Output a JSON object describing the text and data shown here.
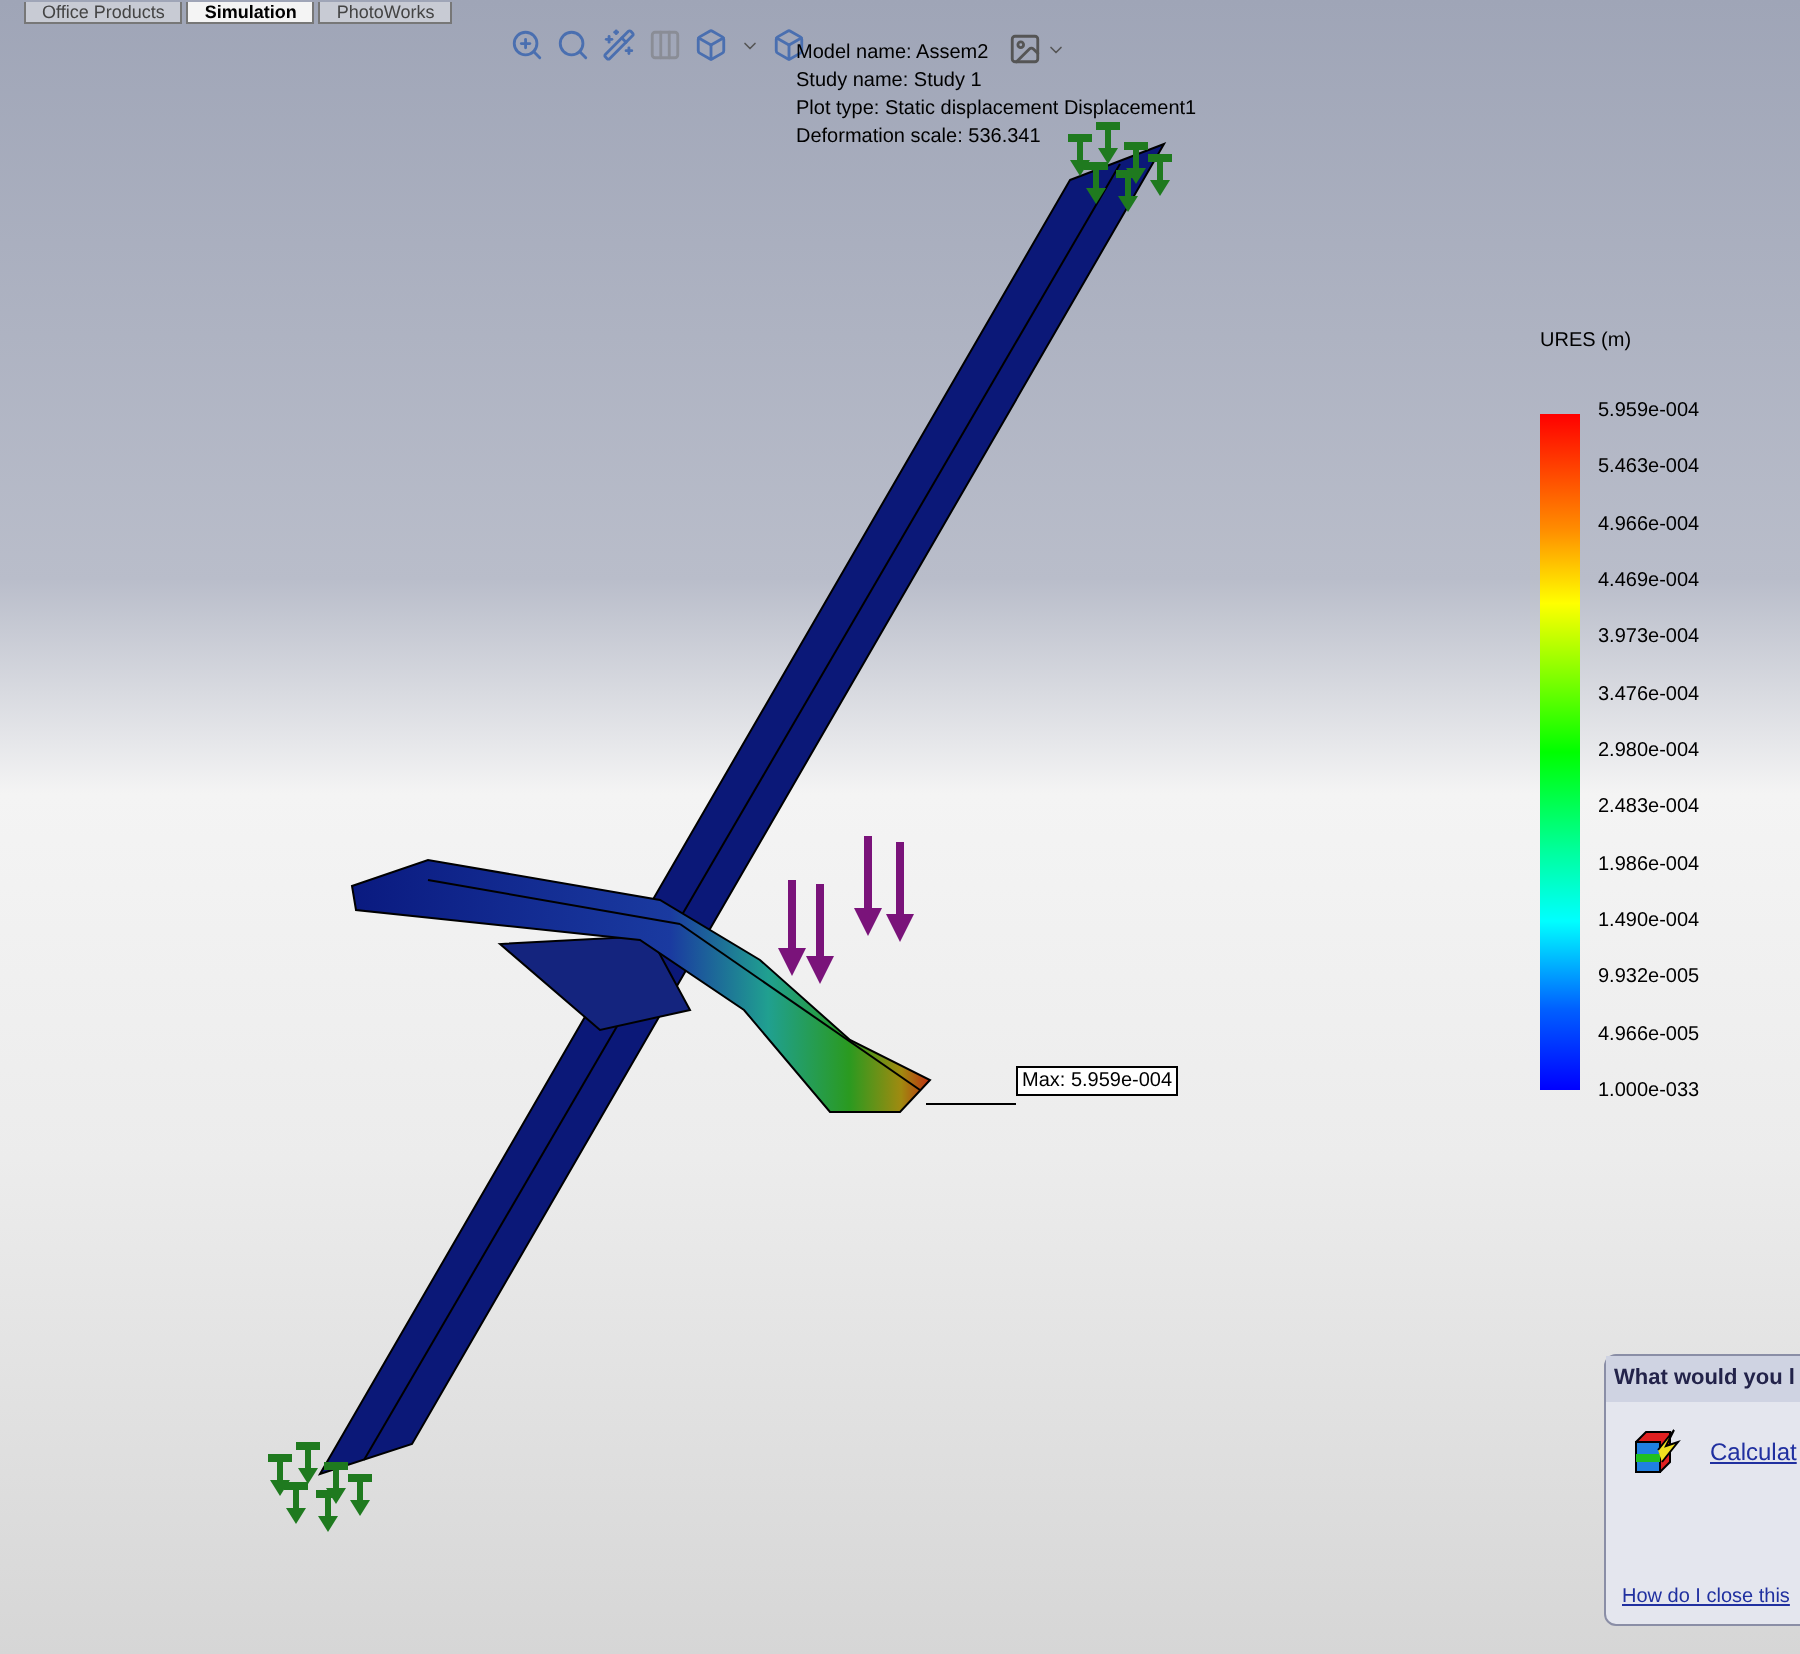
{
  "tabs": [
    {
      "label": "Office Products",
      "selected": false
    },
    {
      "label": "Simulation",
      "selected": true
    },
    {
      "label": "PhotoWorks",
      "selected": false
    }
  ],
  "plot_info": [
    "Model name: Assem2",
    "Study name: Study 1",
    "Plot type: Static displacement Displacement1",
    "Deformation scale: 536.341"
  ],
  "legend": {
    "title": "URES (m)",
    "labels": [
      "5.959e-004",
      "5.463e-004",
      "4.966e-004",
      "4.469e-004",
      "3.973e-004",
      "3.476e-004",
      "2.980e-004",
      "2.483e-004",
      "1.986e-004",
      "1.490e-004",
      "9.932e-005",
      "4.966e-005",
      "1.000e-033"
    ]
  },
  "max_label": "Max: 5.959e-004",
  "help_panel": {
    "title": "What would you l",
    "link": "Calculat",
    "footer_link": "How do I close this"
  }
}
